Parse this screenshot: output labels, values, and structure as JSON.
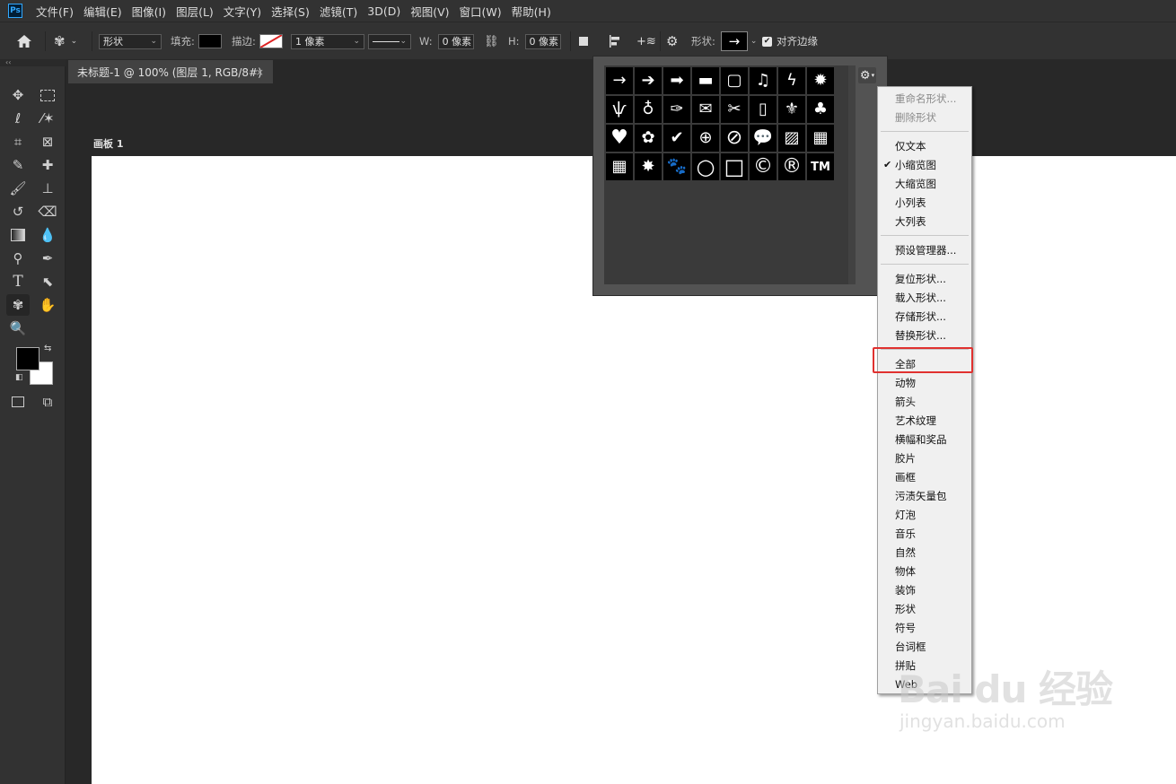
{
  "app_logo": "Ps",
  "menu": [
    "文件(F)",
    "编辑(E)",
    "图像(I)",
    "图层(L)",
    "文字(Y)",
    "选择(S)",
    "滤镜(T)",
    "3D(D)",
    "视图(V)",
    "窗口(W)",
    "帮助(H)"
  ],
  "options": {
    "mode": "形状",
    "fill_label": "填充:",
    "stroke_label": "描边:",
    "stroke_width": "1 像素",
    "w_label": "W:",
    "w_value": "0 像素",
    "h_label": "H:",
    "h_value": "0 像素",
    "shape_label": "形状:",
    "align_edges": "对齐边缘"
  },
  "document_tab": {
    "title": "未标题-1 @ 100% (图层 1, RGB/8#)",
    "close": "×"
  },
  "artboard_label": "画板 1",
  "shapes": [
    "→",
    "➔",
    "➡",
    "▬",
    "▢",
    "♫",
    "ϟ",
    "✹",
    "ѱ",
    "♁",
    "✑",
    "✉",
    "✂",
    "▯",
    "⚜",
    "♣",
    "♥",
    "✿",
    "✔",
    "⊕",
    "⊘",
    "💬",
    "▨",
    "▦",
    "▦",
    "✸",
    "🐾",
    "○",
    "□",
    "©",
    "®",
    "TM"
  ],
  "context_menu": {
    "group1": [
      "重命名形状...",
      "删除形状"
    ],
    "group2": [
      "仅文本",
      "小缩览图",
      "大缩览图",
      "小列表",
      "大列表"
    ],
    "checked": "小缩览图",
    "group3": [
      "预设管理器..."
    ],
    "group4": [
      "复位形状...",
      "载入形状...",
      "存储形状...",
      "替换形状..."
    ],
    "group5": [
      "全部",
      "动物",
      "箭头",
      "艺术纹理",
      "横幅和奖品",
      "胶片",
      "画框",
      "污渍矢量包",
      "灯泡",
      "音乐",
      "自然",
      "物体",
      "装饰",
      "形状",
      "符号",
      "台词框",
      "拼贴",
      "Web"
    ]
  },
  "watermark": {
    "main": "Bai du 经验",
    "sub": "jingyan.baidu.com"
  },
  "colors": {
    "highlight": "#e0312f",
    "bg_dark": "#282828",
    "panel": "#323232"
  }
}
